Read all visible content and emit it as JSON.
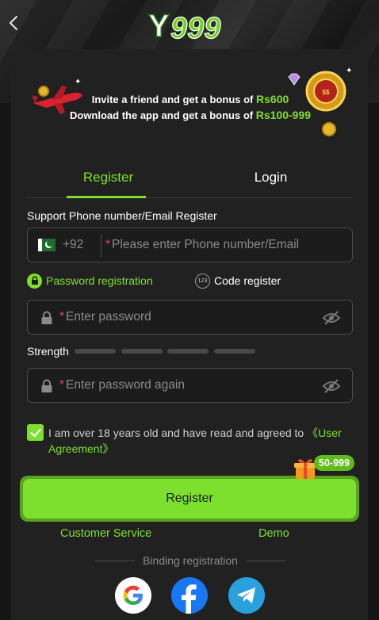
{
  "header": {
    "logo_text": "Y999",
    "back_icon": "chevron-left-icon"
  },
  "banner": {
    "line1_text": "Invite a friend and get a bonus of",
    "line1_amount": "Rs600",
    "line2_text": "Download the app and get a bonus of",
    "line2_amount": "Rs100-999"
  },
  "tabs": [
    {
      "label": "Register",
      "active": true
    },
    {
      "label": "Login",
      "active": false
    }
  ],
  "form": {
    "section_title": "Support Phone number/Email Register",
    "country_code": "+92",
    "phone_placeholder": "Please enter Phone number/Email",
    "required_mark": "*",
    "mode_password": "Password registration",
    "mode_code": "Code register",
    "mode_code_icon_text": "123",
    "password_placeholder": "Enter password",
    "strength_label": "Strength",
    "password_again_placeholder": "Enter password again",
    "agreement_text": "I am over 18 years old and have read and agreed to ",
    "agreement_link": "《User Agreement》",
    "agreement_checked": true,
    "register_button": "Register",
    "bonus_badge": "50-999"
  },
  "footer": {
    "customer_service": "Customer Service",
    "demo": "Demo",
    "binding_label": "Binding registration",
    "socials": [
      "google-icon",
      "facebook-icon",
      "telegram-icon"
    ]
  },
  "colors": {
    "accent": "#7ee02e",
    "background": "#151515",
    "card": "#212121",
    "required": "#e04848"
  }
}
